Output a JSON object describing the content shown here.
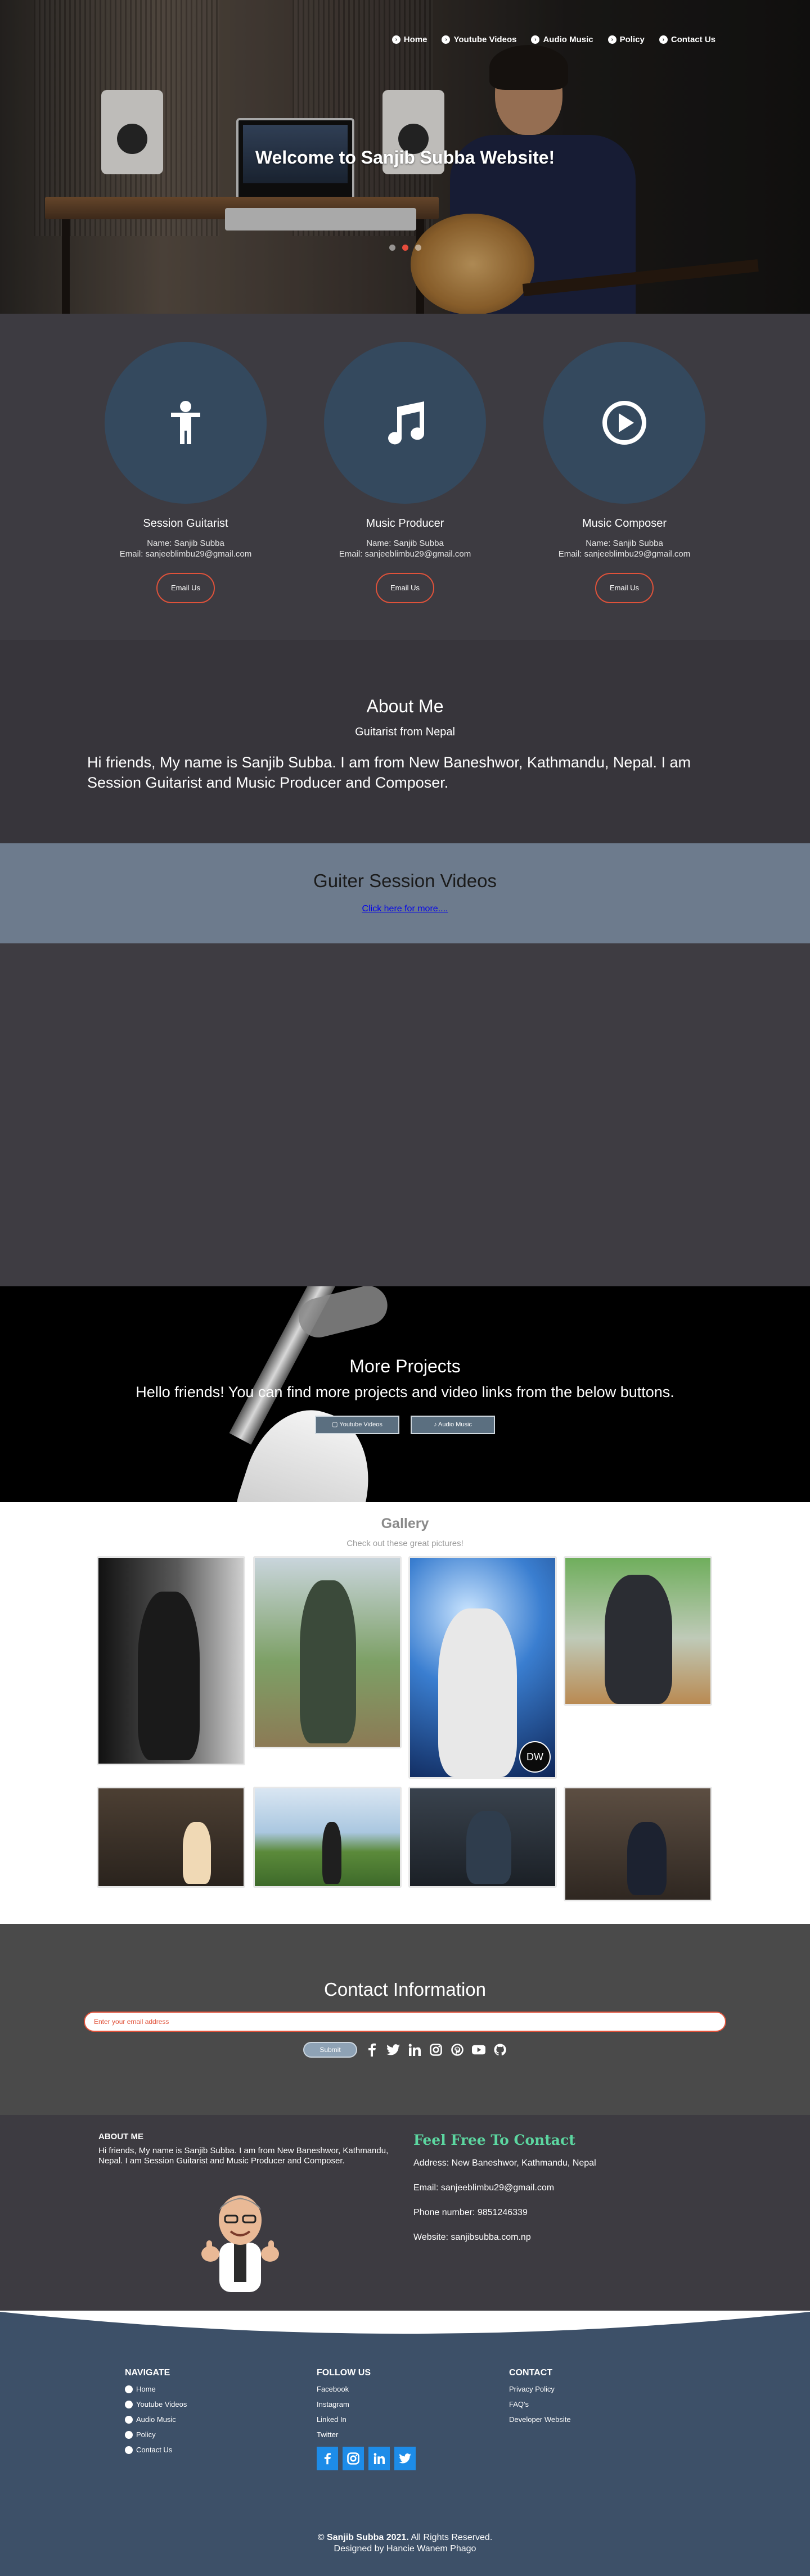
{
  "nav": {
    "items": [
      "Home",
      "Youtube Videos",
      "Audio Music",
      "Policy",
      "Contact Us"
    ]
  },
  "hero": {
    "title": "Welcome to Sanjib Subba Website!"
  },
  "services": [
    {
      "title": "Session Guitarist",
      "name": "Name: Sanjib Subba",
      "email": "Email: sanjeeblimbu29@gmail.com",
      "button": "Email Us",
      "icon": "person-icon"
    },
    {
      "title": "Music Producer",
      "name": "Name: Sanjib Subba",
      "email": "Email: sanjeeblimbu29@gmail.com",
      "button": "Email Us",
      "icon": "music-note-icon"
    },
    {
      "title": "Music Composer",
      "name": "Name: Sanjib Subba",
      "email": "Email: sanjeeblimbu29@gmail.com",
      "button": "Email Us",
      "icon": "play-circle-icon"
    }
  ],
  "about": {
    "title": "About Me",
    "subtitle": "Guitarist from Nepal",
    "bio": "Hi friends, My name is Sanjib Subba. I am from New Baneshwor, Kathmandu, Nepal. I am Session Guitarist and Music Producer and Composer."
  },
  "session": {
    "title": "Guiter Session Videos",
    "link": "Click here for more...."
  },
  "projects": {
    "title": "More Projects",
    "text": "Hello friends! You can find more projects and video links from the below buttons.",
    "buttons": [
      "Youtube Videos",
      "Audio Music"
    ]
  },
  "gallery": {
    "title": "Gallery",
    "subtitle": "Check out these great pictures!",
    "logo_text": "DW"
  },
  "contact": {
    "title": "Contact Information",
    "placeholder": "Enter your email address",
    "submit": "Submit",
    "socials": [
      "facebook-icon",
      "twitter-icon",
      "linkedin-icon",
      "instagram-icon",
      "pinterest-icon",
      "youtube-icon",
      "github-icon"
    ]
  },
  "footer_top": {
    "about_title": "ABOUT ME",
    "about_text": "Hi friends, My name is Sanjib Subba. I am from New Baneshwor, Kathmandu, Nepal. I am Session Guitarist and Music Producer and Composer.",
    "contact_title": "Feel Free To Contact",
    "address": "Address: New Baneshwor, Kathmandu, Nepal",
    "email": "Email: sanjeeblimbu29@gmail.com",
    "phone": "Phone number: 9851246339",
    "website": "Website: sanjibsubba.com.np"
  },
  "footer": {
    "navigate_title": "NAVIGATE",
    "navigate": [
      "Home",
      "Youtube Videos",
      "Audio Music",
      "Policy",
      "Contact Us"
    ],
    "follow_title": "FOLLOW US",
    "follow": [
      "Facebook",
      "Instagram",
      "Linked In",
      "Twitter"
    ],
    "contact_title": "CONTACT",
    "contact": [
      "Privacy Policy",
      "FAQ's",
      "Developer Website"
    ],
    "copyright_brand": "© Sanjib Subba 2021.",
    "copyright_rest": " All Rights Reserved.",
    "designer": "Designed by Hancie Wanem Phago"
  },
  "colors": {
    "accent": "#e0523a",
    "circle": "#34495e",
    "brand_green": "#5cd6a0",
    "footer_blue": "#3d5068"
  }
}
